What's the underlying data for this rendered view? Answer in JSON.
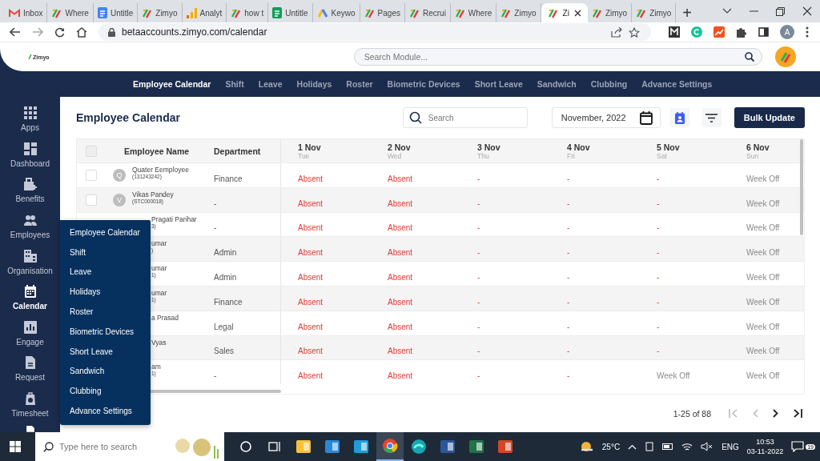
{
  "browser": {
    "tabs": [
      {
        "title": "Inbox",
        "kind": "mail",
        "selected": false
      },
      {
        "title": "Where",
        "kind": "slash",
        "selected": false
      },
      {
        "title": "Untitle",
        "kind": "doc",
        "selected": false
      },
      {
        "title": "Zimyo",
        "kind": "slash",
        "selected": false
      },
      {
        "title": "Analyt",
        "kind": "bars",
        "selected": false
      },
      {
        "title": "how t",
        "kind": "slash",
        "selected": false
      },
      {
        "title": "Untitle",
        "kind": "sheet",
        "selected": false
      },
      {
        "title": "Keywo",
        "kind": "triangle",
        "selected": false
      },
      {
        "title": "Pages",
        "kind": "slash",
        "selected": false
      },
      {
        "title": "Recrui",
        "kind": "slash",
        "selected": false
      },
      {
        "title": "Where",
        "kind": "slash",
        "selected": false
      },
      {
        "title": "Zimyo",
        "kind": "slash",
        "selected": false
      },
      {
        "title": "Zi",
        "kind": "slash",
        "selected": true
      },
      {
        "title": "Zimyo",
        "kind": "slash",
        "selected": false
      },
      {
        "title": "Zimyo",
        "kind": "slash",
        "selected": false
      }
    ],
    "new_tab": "+",
    "url": "betaaccounts.zimyo.com/calendar",
    "profile": "A"
  },
  "header": {
    "logo": "Zimyo",
    "search": {
      "placeholder": "Search Module..."
    }
  },
  "top_nav": [
    {
      "label": "Employee Calendar",
      "selected": true
    },
    {
      "label": "Shift",
      "selected": false
    },
    {
      "label": "Leave",
      "selected": false
    },
    {
      "label": "Holidays",
      "selected": false
    },
    {
      "label": "Roster",
      "selected": false
    },
    {
      "label": "Biometric Devices",
      "selected": false
    },
    {
      "label": "Short Leave",
      "selected": false
    },
    {
      "label": "Sandwich",
      "selected": false
    },
    {
      "label": "Clubbing",
      "selected": false
    },
    {
      "label": "Advance Settings",
      "selected": false
    }
  ],
  "sidebar": {
    "items": [
      {
        "label": "Apps",
        "selected": false
      },
      {
        "label": "Dashboard",
        "selected": false
      },
      {
        "label": "Benefits",
        "selected": false
      },
      {
        "label": "Employees",
        "selected": false
      },
      {
        "label": "Organisation",
        "selected": false
      },
      {
        "label": "Calendar",
        "selected": true
      },
      {
        "label": "Engage",
        "selected": false
      },
      {
        "label": "Request",
        "selected": false
      },
      {
        "label": "Timesheet",
        "selected": false
      }
    ]
  },
  "flyout_menu": [
    "Employee Calendar",
    "Shift",
    "Leave",
    "Holidays",
    "Roster",
    "Biometric Devices",
    "Short Leave",
    "Sandwich",
    "Clubbing",
    "Advance Settings"
  ],
  "page": {
    "title": "Employee Calendar",
    "search": {
      "placeholder": "Search"
    },
    "month": "November, 2022",
    "bulk_button": "Bulk Update"
  },
  "table": {
    "select_all_checked": false,
    "columns": [
      "Employee Name",
      "Department"
    ],
    "days": [
      {
        "date": "1 Nov",
        "weekday": "Tue"
      },
      {
        "date": "2 Nov",
        "weekday": "Wed"
      },
      {
        "date": "3 Nov",
        "weekday": "Thu"
      },
      {
        "date": "4 Nov",
        "weekday": "Fri"
      },
      {
        "date": "5 Nov",
        "weekday": "Sat"
      },
      {
        "date": "6 Nov",
        "weekday": "Sun"
      }
    ],
    "rows": [
      {
        "kind": "full",
        "checked": false,
        "initial": "Q",
        "name": "Quater Eemployee",
        "code": "(131243242)",
        "department": "Finance",
        "cells": [
          {
            "text": "Absent",
            "kind": "absent"
          },
          {
            "text": "Absent",
            "kind": "absent"
          },
          {
            "text": "-",
            "kind": "none"
          },
          {
            "text": "-",
            "kind": "none"
          },
          {
            "text": "-",
            "kind": "none"
          },
          {
            "text": "Week Off",
            "kind": "off"
          }
        ]
      },
      {
        "kind": "full",
        "checked": false,
        "initial": "V",
        "name": "Vikas Pandey",
        "code": "(STC000018)",
        "department": "-",
        "cells": [
          {
            "text": "Absent",
            "kind": "absent"
          },
          {
            "text": "Absent",
            "kind": "absent"
          },
          {
            "text": "-",
            "kind": "none"
          },
          {
            "text": "-",
            "kind": "none"
          },
          {
            "text": "-",
            "kind": "none"
          },
          {
            "text": "Week Off",
            "kind": "off"
          }
        ]
      },
      {
        "kind": "partial",
        "name": "Pragati Parihar",
        "code": "3)",
        "department": "-",
        "cells": [
          {
            "text": "Absent",
            "kind": "absent"
          },
          {
            "text": "Absent",
            "kind": "absent"
          },
          {
            "text": "-",
            "kind": "none"
          },
          {
            "text": "-",
            "kind": "none"
          },
          {
            "text": "-",
            "kind": "none"
          },
          {
            "text": "Week Off",
            "kind": "off"
          }
        ]
      },
      {
        "kind": "partial",
        "name": "umar",
        "code": ")",
        "department": "Admin",
        "cells": [
          {
            "text": "Absent",
            "kind": "absent"
          },
          {
            "text": "Absent",
            "kind": "absent"
          },
          {
            "text": "-",
            "kind": "none"
          },
          {
            "text": "-",
            "kind": "none"
          },
          {
            "text": "-",
            "kind": "none"
          },
          {
            "text": "Week Off",
            "kind": "off"
          }
        ]
      },
      {
        "kind": "partial",
        "name": "umar",
        "code": "1)",
        "department": "Admin",
        "cells": [
          {
            "text": "Absent",
            "kind": "absent"
          },
          {
            "text": "Absent",
            "kind": "absent"
          },
          {
            "text": "-",
            "kind": "none"
          },
          {
            "text": "-",
            "kind": "none"
          },
          {
            "text": "-",
            "kind": "none"
          },
          {
            "text": "Week Off",
            "kind": "off"
          }
        ]
      },
      {
        "kind": "partial",
        "name": "umar",
        "code": "1)",
        "department": "Finance",
        "cells": [
          {
            "text": "Absent",
            "kind": "absent"
          },
          {
            "text": "Absent",
            "kind": "absent"
          },
          {
            "text": "-",
            "kind": "none"
          },
          {
            "text": "-",
            "kind": "none"
          },
          {
            "text": "-",
            "kind": "none"
          },
          {
            "text": "Week Off",
            "kind": "off"
          }
        ]
      },
      {
        "kind": "partial",
        "name": "a Prasad",
        "department": "Legal",
        "cells": [
          {
            "text": "Absent",
            "kind": "absent"
          },
          {
            "text": "Absent",
            "kind": "absent"
          },
          {
            "text": "-",
            "kind": "none"
          },
          {
            "text": "-",
            "kind": "none"
          },
          {
            "text": "-",
            "kind": "none"
          },
          {
            "text": "Week Off",
            "kind": "off"
          }
        ]
      },
      {
        "kind": "partial",
        "name": "Vyas",
        "department": "Sales",
        "cells": [
          {
            "text": "Absent",
            "kind": "absent"
          },
          {
            "text": "Absent",
            "kind": "absent"
          },
          {
            "text": "-",
            "kind": "none"
          },
          {
            "text": "-",
            "kind": "none"
          },
          {
            "text": "-",
            "kind": "none"
          },
          {
            "text": "Week Off",
            "kind": "off"
          }
        ]
      },
      {
        "kind": "partial",
        "name": "am",
        "code": "1)",
        "department": "-",
        "cells": [
          {
            "text": "Absent",
            "kind": "absent"
          },
          {
            "text": "Absent",
            "kind": "absent"
          },
          {
            "text": "-",
            "kind": "none"
          },
          {
            "text": "-",
            "kind": "none"
          },
          {
            "text": "Week Off",
            "kind": "off"
          },
          {
            "text": "Week Off",
            "kind": "off"
          }
        ]
      }
    ]
  },
  "pagination": {
    "range": "1-25 of 88",
    "first_disabled": true,
    "prev_disabled": true
  },
  "taskbar": {
    "search": {
      "placeholder": "Type here to search"
    },
    "apps": [
      {
        "selected": false
      },
      {
        "selected": false
      },
      {
        "selected": false
      },
      {
        "selected": false
      },
      {
        "selected": false
      },
      {
        "selected": true
      },
      {
        "selected": false
      },
      {
        "selected": false
      },
      {
        "selected": false
      },
      {
        "selected": false
      }
    ],
    "weather": "25°C",
    "language": "ENG",
    "time": "10:53",
    "date": "03-11-2022",
    "notifications": "19"
  }
}
